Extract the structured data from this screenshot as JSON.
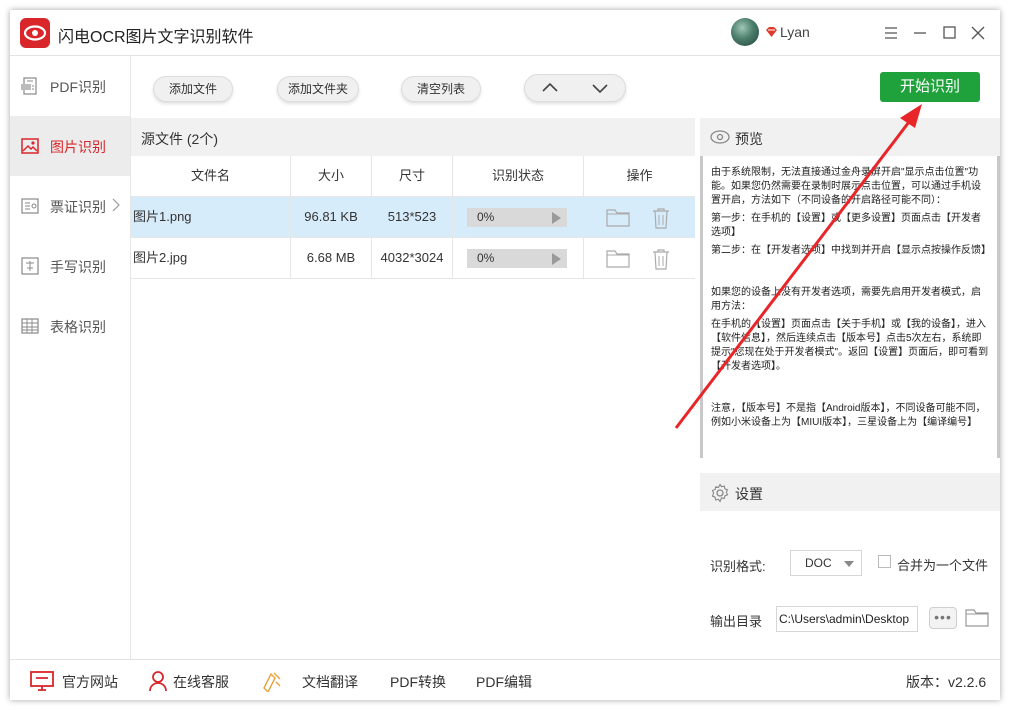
{
  "app": {
    "title": "闪电OCR图片文字识别软件",
    "username": "Lyan"
  },
  "sidebar": {
    "items": [
      {
        "label": "PDF识别",
        "icon": "pdf-doc-icon"
      },
      {
        "label": "图片识别",
        "icon": "image-icon"
      },
      {
        "label": "票证识别",
        "icon": "ticket-icon"
      },
      {
        "label": "手写识别",
        "icon": "handwriting-icon"
      },
      {
        "label": "表格识别",
        "icon": "table-icon"
      }
    ],
    "active_index": 1
  },
  "toolbar": {
    "add_file": "添加文件",
    "add_folder": "添加文件夹",
    "clear_list": "清空列表",
    "start": "开始识别"
  },
  "file_panel": {
    "title": "源文件 (2个)",
    "columns": [
      "文件名",
      "大小",
      "尺寸",
      "识别状态",
      "操作"
    ],
    "rows": [
      {
        "name": "图片1.png",
        "size": "96.81 KB",
        "dims": "513*523",
        "status": "0%",
        "progress": 0
      },
      {
        "name": "图片2.jpg",
        "size": "6.68 MB",
        "dims": "4032*3024",
        "status": "0%",
        "progress": 0
      }
    ]
  },
  "preview": {
    "title": "预览",
    "paragraphs": [
      "由于系统限制，无法直接通过金舟录屏开启\"显示点击位置\"功能。如果您仍然需要在录制时展示点击位置，可以通过手机设置开启，方法如下（不同设备的开启路径可能不同）：",
      "第一步：在手机的【设置】或【更多设置】页面点击【开发者选项】",
      "第二步：在【开发者选项】中找到并开启【显示点按操作反馈】",
      "如果您的设备上没有开发者选项，需要先启用开发者模式，启用方法：",
      "在手机的【设置】页面点击【关于手机】或【我的设备】，进入【软件信息】，然后连续点击【版本号】点击5次左右，系统即提示\"您现在处于开发者模式\"。返回【设置】页面后，即可看到【开发者选项】。",
      "注意，【版本号】不是指【Android版本】，不同设备可能不同，例如小米设备上为【MIUI版本】，三星设备上为【编译编号】"
    ]
  },
  "settings": {
    "title": "设置",
    "format_label": "识别格式:",
    "format_value": "DOC",
    "merge_label": "合并为一个文件",
    "output_label": "输出目录",
    "output_path": "C:\\Users\\admin\\Desktop",
    "dots": "•••"
  },
  "footer": {
    "website": "官方网站",
    "support": "在线客服",
    "translate": "文档翻译",
    "pdf_convert": "PDF转换",
    "pdf_edit": "PDF编辑",
    "version": "版本：v2.2.6"
  },
  "colors": {
    "brand_red": "#d8262a",
    "start_green": "#1fa23b",
    "selected_row": "#d7ecfb",
    "arrow_red": "#e8262a"
  }
}
